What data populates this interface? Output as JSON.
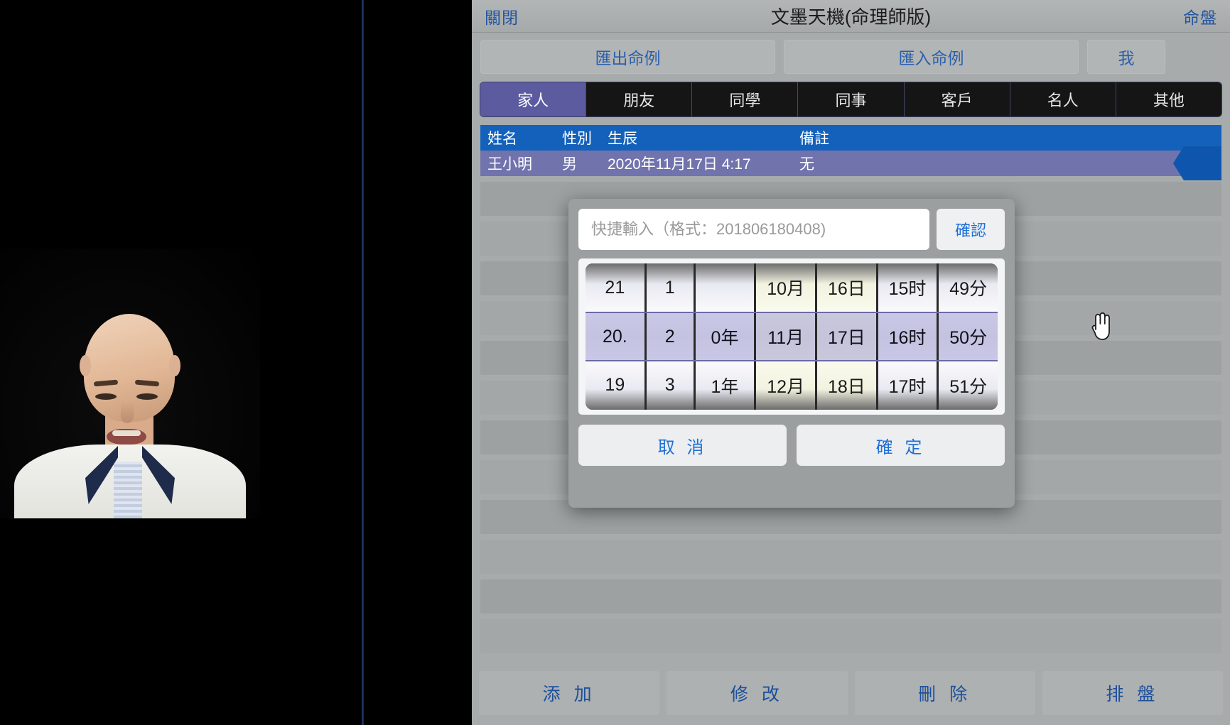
{
  "titlebar": {
    "close_label": "關閉",
    "title": "文墨天機(命理師版)",
    "chart_label": "命盤"
  },
  "toolbar": {
    "export_label": "匯出命例",
    "import_label": "匯入命例",
    "me_label": "我"
  },
  "tabs": [
    {
      "label": "家人",
      "active": true
    },
    {
      "label": "朋友",
      "active": false
    },
    {
      "label": "同學",
      "active": false
    },
    {
      "label": "同事",
      "active": false
    },
    {
      "label": "客戶",
      "active": false
    },
    {
      "label": "名人",
      "active": false
    },
    {
      "label": "其他",
      "active": false
    }
  ],
  "table": {
    "headers": {
      "name": "姓名",
      "gender": "性別",
      "birth": "生辰",
      "note": "備註"
    },
    "rows": [
      {
        "name": "王小明",
        "gender": "男",
        "birth": "2020年11月17日 4:17",
        "note": "无"
      }
    ]
  },
  "dialog": {
    "quick_input_placeholder": "快捷輸入（格式：201806180408)",
    "quick_input_value": "",
    "quick_confirm_label": "確認",
    "cancel_label": "取 消",
    "confirm_label": "確 定",
    "picker": {
      "columns": [
        {
          "name": "century",
          "tint": false,
          "narrow": false,
          "cells": [
            "21",
            "20.",
            "19"
          ],
          "selected_index": 1
        },
        {
          "name": "decade",
          "tint": false,
          "narrow": true,
          "cells": [
            "1",
            "2",
            "3"
          ],
          "selected_index": 1
        },
        {
          "name": "year",
          "tint": false,
          "narrow": false,
          "cells": [
            "",
            "0年",
            "1年"
          ],
          "selected_index": 1
        },
        {
          "name": "month",
          "tint": true,
          "narrow": false,
          "cells": [
            "10月",
            "11月",
            "12月"
          ],
          "selected_index": 1
        },
        {
          "name": "day",
          "tint": true,
          "narrow": false,
          "cells": [
            "16日",
            "17日",
            "18日"
          ],
          "selected_index": 1
        },
        {
          "name": "hour",
          "tint": false,
          "narrow": false,
          "cells": [
            "15时",
            "16时",
            "17时"
          ],
          "selected_index": 1
        },
        {
          "name": "minute",
          "tint": false,
          "narrow": false,
          "cells": [
            "49分",
            "50分",
            "51分"
          ],
          "selected_index": 1
        }
      ]
    }
  },
  "bottom_actions": [
    {
      "label": "添 加"
    },
    {
      "label": "修 改"
    },
    {
      "label": "刪 除"
    },
    {
      "label": "排 盤"
    }
  ],
  "colors": {
    "accent_link": "#23559e",
    "tab_active": "#5c5ba0",
    "table_header": "#1361bb",
    "table_row": "#7173ad",
    "app_bg": "#a7abab",
    "dialog_bg": "#9b9f9f",
    "picker_selection": "#6d6aa8"
  }
}
